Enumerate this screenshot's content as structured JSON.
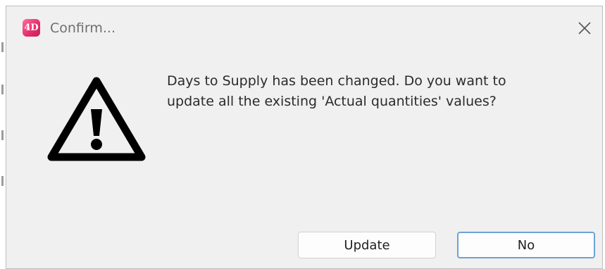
{
  "dialog": {
    "title": "Confirm...",
    "app_icon_text": "4D",
    "icon": "warning-triangle-icon",
    "message_lines": [
      "Days to Supply has been changed. Do you want to",
      "update all the existing 'Actual quantities' values?"
    ],
    "buttons": {
      "update_label": "Update",
      "no_label": "No"
    },
    "default_button": "No"
  },
  "colors": {
    "dialog_background": "#f0f0f0",
    "app_icon": "#e8306d",
    "default_button_border": "#6da3d6"
  }
}
